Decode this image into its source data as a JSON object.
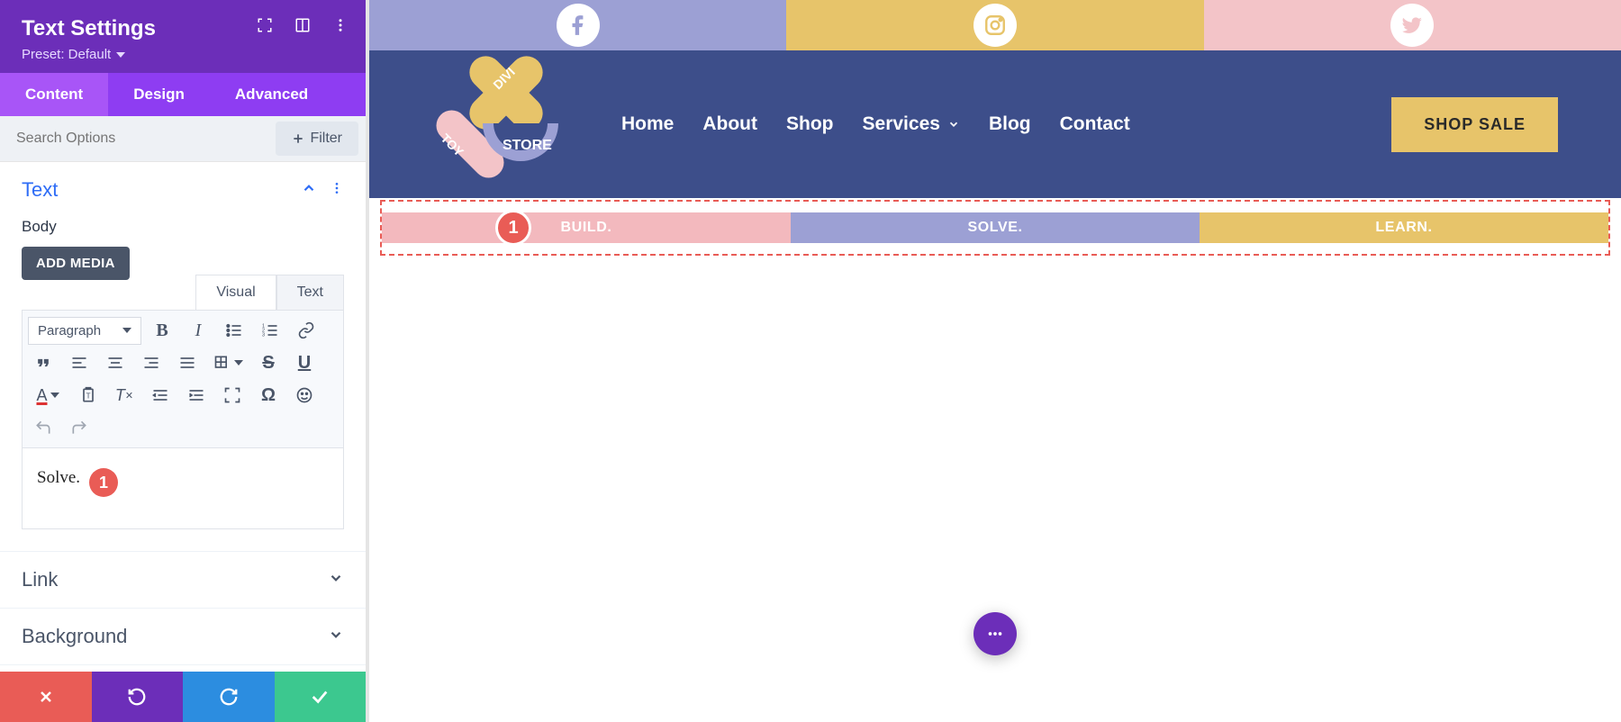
{
  "panel": {
    "title": "Text Settings",
    "preset_label": "Preset: Default",
    "tabs": {
      "content": "Content",
      "design": "Design",
      "advanced": "Advanced"
    },
    "search_placeholder": "Search Options",
    "filter_label": "Filter",
    "sections": {
      "text": {
        "title": "Text",
        "body_label": "Body",
        "add_media": "ADD MEDIA"
      },
      "link": {
        "title": "Link"
      },
      "background": {
        "title": "Background"
      }
    },
    "editor": {
      "mode_visual": "Visual",
      "mode_text": "Text",
      "paragraph_label": "Paragraph",
      "content": "Solve.",
      "marker": "1"
    }
  },
  "preview": {
    "nav": {
      "items": [
        "Home",
        "About",
        "Shop",
        "Services",
        "Blog",
        "Contact"
      ],
      "cta": "SHOP SALE",
      "logo": {
        "t1": "DIVI",
        "t2": "TOY",
        "t3": "STORE"
      }
    },
    "tags": {
      "marker": "1",
      "items": [
        "BUILD.",
        "SOLVE.",
        "LEARN."
      ]
    }
  },
  "colors": {
    "brand_purple": "#6C2EB9",
    "accent_gold": "#E7C46A",
    "accent_lavender": "#9CA0D4",
    "accent_pink": "#F3C4C8",
    "navy": "#3D4E8A",
    "danger": "#E95C56"
  }
}
